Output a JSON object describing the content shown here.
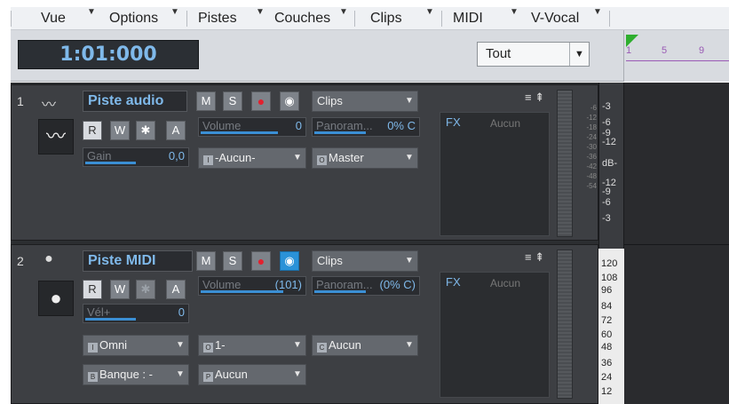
{
  "menubar": {
    "items": [
      "Vue",
      "Options",
      "Pistes",
      "Couches",
      "Clips",
      "MIDI",
      "V-Vocal"
    ]
  },
  "transport": {
    "timecode": "1:01:000",
    "filter_value": "Tout",
    "ruler_labels": [
      "1",
      "5",
      "9"
    ]
  },
  "tracks": [
    {
      "number": "1",
      "name": "Piste audio",
      "icon": "audio-waveform-icon",
      "buttons": [
        "M",
        "S",
        "R",
        "W",
        "A"
      ],
      "input_dropdown": "Clips",
      "volume_label": "Volume",
      "volume_value": "0",
      "volume_fraction": 0.75,
      "pan_label": "Panoram...",
      "pan_value": "0% C",
      "pan_fraction": 0.5,
      "gain_label": "Gain",
      "gain_value": "0,0",
      "gain_fraction": 0.5,
      "input_value": "-Aucun-",
      "output_value": "Master",
      "fx_label": "FX",
      "fx_value": "Aucun",
      "meter_scale": [
        "-6",
        "-12",
        "-18",
        "-24",
        "-30",
        "-36",
        "-42",
        "-48",
        "-54"
      ],
      "vscale": [
        "-3",
        "-6",
        "-9",
        "-12",
        "dB-",
        "-12",
        "-9",
        "-6",
        "-3"
      ]
    },
    {
      "number": "2",
      "name": "Piste MIDI",
      "icon": "midi-din-icon",
      "buttons": [
        "M",
        "S",
        "R",
        "W",
        "A"
      ],
      "input_dropdown": "Clips",
      "volume_label": "Volume",
      "volume_value": "(101)",
      "volume_fraction": 0.8,
      "pan_label": "Panoram...",
      "pan_value": "(0% C)",
      "pan_fraction": 0.5,
      "vel_label": "Vél+",
      "vel_value": "0",
      "vel_fraction": 0.5,
      "channel_input": "Omni",
      "channel_output": "1-",
      "output_value": "Aucun",
      "bank_value": "Banque : -",
      "patch_value": "Aucun",
      "fx_label": "FX",
      "fx_value": "Aucun",
      "vscale": [
        "120",
        "108",
        "96",
        "84",
        "72",
        "60",
        "48",
        "36",
        "24",
        "12"
      ]
    }
  ]
}
